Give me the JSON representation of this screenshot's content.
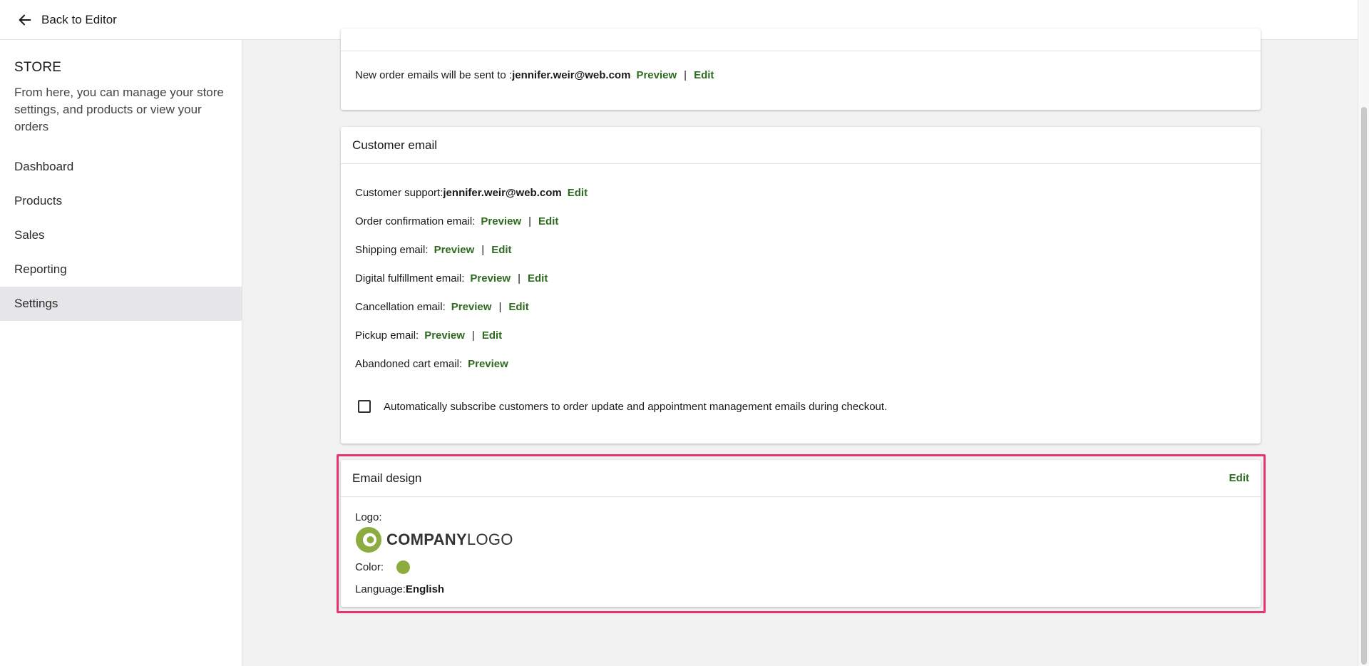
{
  "topbar": {
    "back_label": "Back to Editor"
  },
  "sidebar": {
    "title": "STORE",
    "description": "From here, you can manage your store settings, and products or view your orders",
    "items": [
      {
        "label": "Dashboard"
      },
      {
        "label": "Products"
      },
      {
        "label": "Sales"
      },
      {
        "label": "Reporting"
      },
      {
        "label": "Settings",
        "active": true
      }
    ]
  },
  "owner_card": {
    "prefix": "New order emails will be sent to : ",
    "email": "jennifer.weir@web.com",
    "preview": "Preview",
    "separator": "|",
    "edit": "Edit"
  },
  "customer_email": {
    "title": "Customer email",
    "support_label": "Customer support: ",
    "support_email": "jennifer.weir@web.com",
    "support_edit": "Edit",
    "rows": [
      {
        "label": "Order confirmation email:",
        "preview": "Preview",
        "separator": "|",
        "edit": "Edit"
      },
      {
        "label": "Shipping email:",
        "preview": "Preview",
        "separator": "|",
        "edit": "Edit"
      },
      {
        "label": "Digital fulfillment email:",
        "preview": "Preview",
        "separator": "|",
        "edit": "Edit"
      },
      {
        "label": "Cancellation email:",
        "preview": "Preview",
        "separator": "|",
        "edit": "Edit"
      },
      {
        "label": "Pickup email:",
        "preview": "Preview",
        "separator": "|",
        "edit": "Edit"
      },
      {
        "label": "Abandoned cart email:",
        "preview": "Preview"
      }
    ],
    "auto_subscribe_label": "Automatically subscribe customers to order update and appointment management emails during checkout.",
    "auto_subscribe_checked": false
  },
  "email_design": {
    "title": "Email design",
    "edit": "Edit",
    "logo_label": "Logo:",
    "logo_text_bold": "COMPANY",
    "logo_text_light": "LOGO",
    "color_label": "Color:",
    "color_value": "#8cac3f",
    "language_label": "Language: ",
    "language_value": "English"
  },
  "colors": {
    "link_green": "#2e6b1f",
    "highlight_pink": "#e8336f",
    "sidebar_active": "#e6e6e9"
  }
}
